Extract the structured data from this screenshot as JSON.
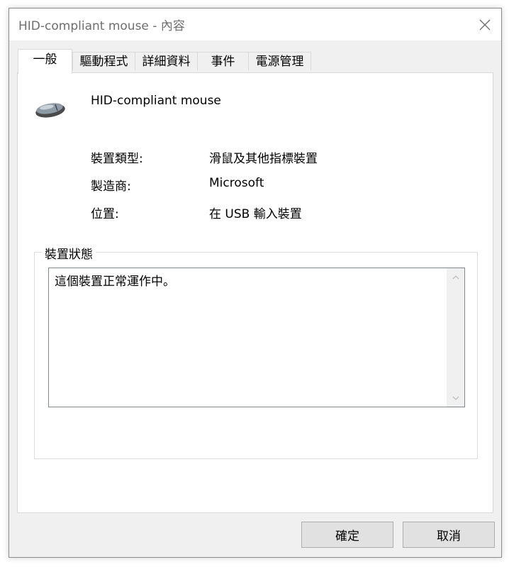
{
  "window": {
    "title": "HID-compliant mouse - 內容"
  },
  "tabs": [
    {
      "label": "一般",
      "active": true
    },
    {
      "label": "驅動程式",
      "active": false
    },
    {
      "label": "詳細資料",
      "active": false
    },
    {
      "label": "事件",
      "active": false
    },
    {
      "label": "電源管理",
      "active": false
    }
  ],
  "general": {
    "device_name": "HID-compliant mouse",
    "device_icon": "mouse-icon",
    "properties": [
      {
        "label": "裝置類型:",
        "value": "滑鼠及其他指標裝置"
      },
      {
        "label": "製造商:",
        "value": "Microsoft"
      },
      {
        "label": "位置:",
        "value": "在 USB 輸入裝置"
      }
    ],
    "status_group": {
      "legend": "裝置狀態",
      "text": "這個裝置正常運作中。"
    }
  },
  "buttons": {
    "ok": "確定",
    "cancel": "取消"
  }
}
